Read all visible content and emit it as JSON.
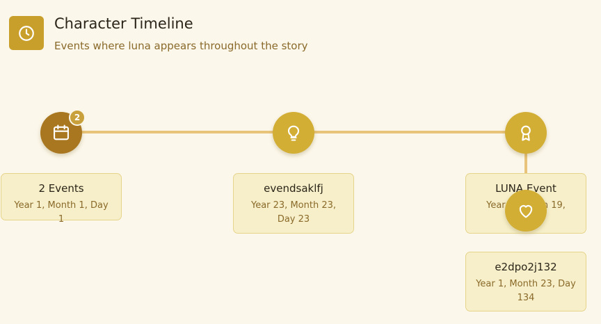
{
  "header": {
    "icon": "clock-icon",
    "title": "Character Timeline",
    "subtitle": "Events where luna appears throughout the story"
  },
  "timeline": {
    "nodes": [
      {
        "icon": "calendar-icon",
        "badge": "2",
        "color": "#a8771f"
      },
      {
        "icon": "lightbulb-icon",
        "color": "#d2ae34"
      },
      {
        "icon": "award-icon",
        "color": "#d2ae34"
      },
      {
        "icon": "heart-icon",
        "color": "#d2ae34"
      }
    ],
    "events": [
      {
        "title": "2 Events",
        "date": "Year 1, Month 1, Day 1"
      },
      {
        "title": "evendsaklfj",
        "date": "Year 23, Month 23, Day 23"
      },
      {
        "title": "LUNA Event",
        "date": "Year 2, Month 19,"
      },
      {
        "title": "e2dpo2j132",
        "date": "Year 1, Month 23, Day 134"
      }
    ]
  },
  "colors": {
    "background": "#fbf7ea",
    "accent": "#c99f2b",
    "line": "#e8c47a",
    "card": "#f6efc9"
  }
}
